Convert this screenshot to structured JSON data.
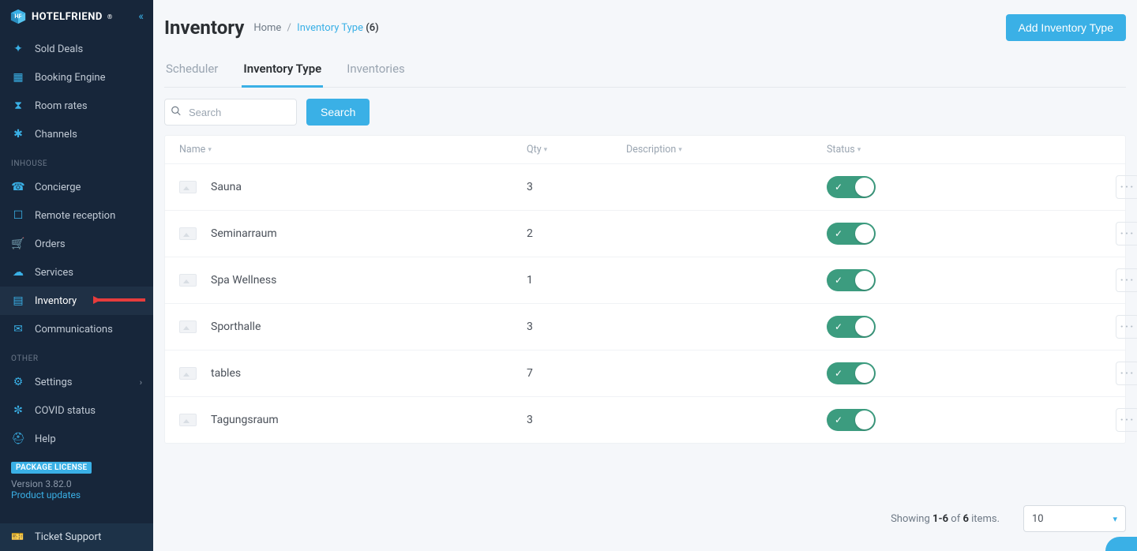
{
  "brand": {
    "name": "HOTELFRIEND"
  },
  "sidebar": {
    "top_items": [
      {
        "label": "Sold Deals",
        "icon": "✦"
      },
      {
        "label": "Booking Engine",
        "icon": "▦"
      },
      {
        "label": "Room rates",
        "icon": "⧗"
      },
      {
        "label": "Channels",
        "icon": "✱"
      }
    ],
    "sections": {
      "inhouse": "INHOUSE",
      "other": "OTHER"
    },
    "inhouse_items": [
      {
        "label": "Concierge",
        "icon": "☎"
      },
      {
        "label": "Remote reception",
        "icon": "☐"
      },
      {
        "label": "Orders",
        "icon": "🛒"
      },
      {
        "label": "Services",
        "icon": "☁"
      },
      {
        "label": "Inventory",
        "icon": "▤",
        "active": true
      },
      {
        "label": "Communications",
        "icon": "✉"
      }
    ],
    "other_items": [
      {
        "label": "Settings",
        "icon": "⚙",
        "chevron": true
      },
      {
        "label": "COVID status",
        "icon": "✼"
      },
      {
        "label": "Help",
        "icon": "⛑"
      }
    ],
    "footer": {
      "badge": "PACKAGE LICENSE",
      "version": "Version 3.82.0",
      "updates": "Product updates",
      "ticket": "Ticket Support"
    }
  },
  "header": {
    "title": "Inventory",
    "breadcrumb": {
      "home": "Home",
      "current": "Inventory Type",
      "count": "(6)"
    },
    "add_button": "Add Inventory Type"
  },
  "tabs": [
    {
      "label": "Scheduler",
      "active": false
    },
    {
      "label": "Inventory Type",
      "active": true
    },
    {
      "label": "Inventories",
      "active": false
    }
  ],
  "toolbar": {
    "search_placeholder": "Search",
    "search_button": "Search"
  },
  "table": {
    "columns": {
      "name": "Name",
      "qty": "Qty",
      "desc": "Description",
      "status": "Status"
    },
    "rows": [
      {
        "name": "Sauna",
        "qty": "3",
        "desc": "",
        "status": true
      },
      {
        "name": "Seminarraum",
        "qty": "2",
        "desc": "",
        "status": true
      },
      {
        "name": "Spa Wellness",
        "qty": "1",
        "desc": "",
        "status": true
      },
      {
        "name": "Sporthalle",
        "qty": "3",
        "desc": "",
        "status": true
      },
      {
        "name": "tables",
        "qty": "7",
        "desc": "",
        "status": true
      },
      {
        "name": "Tagungsraum",
        "qty": "3",
        "desc": "",
        "status": true
      }
    ]
  },
  "footer": {
    "showing_pre": "Showing ",
    "range": "1-6",
    "mid": " of ",
    "total": "6",
    "post": " items.",
    "page_size": "10"
  }
}
